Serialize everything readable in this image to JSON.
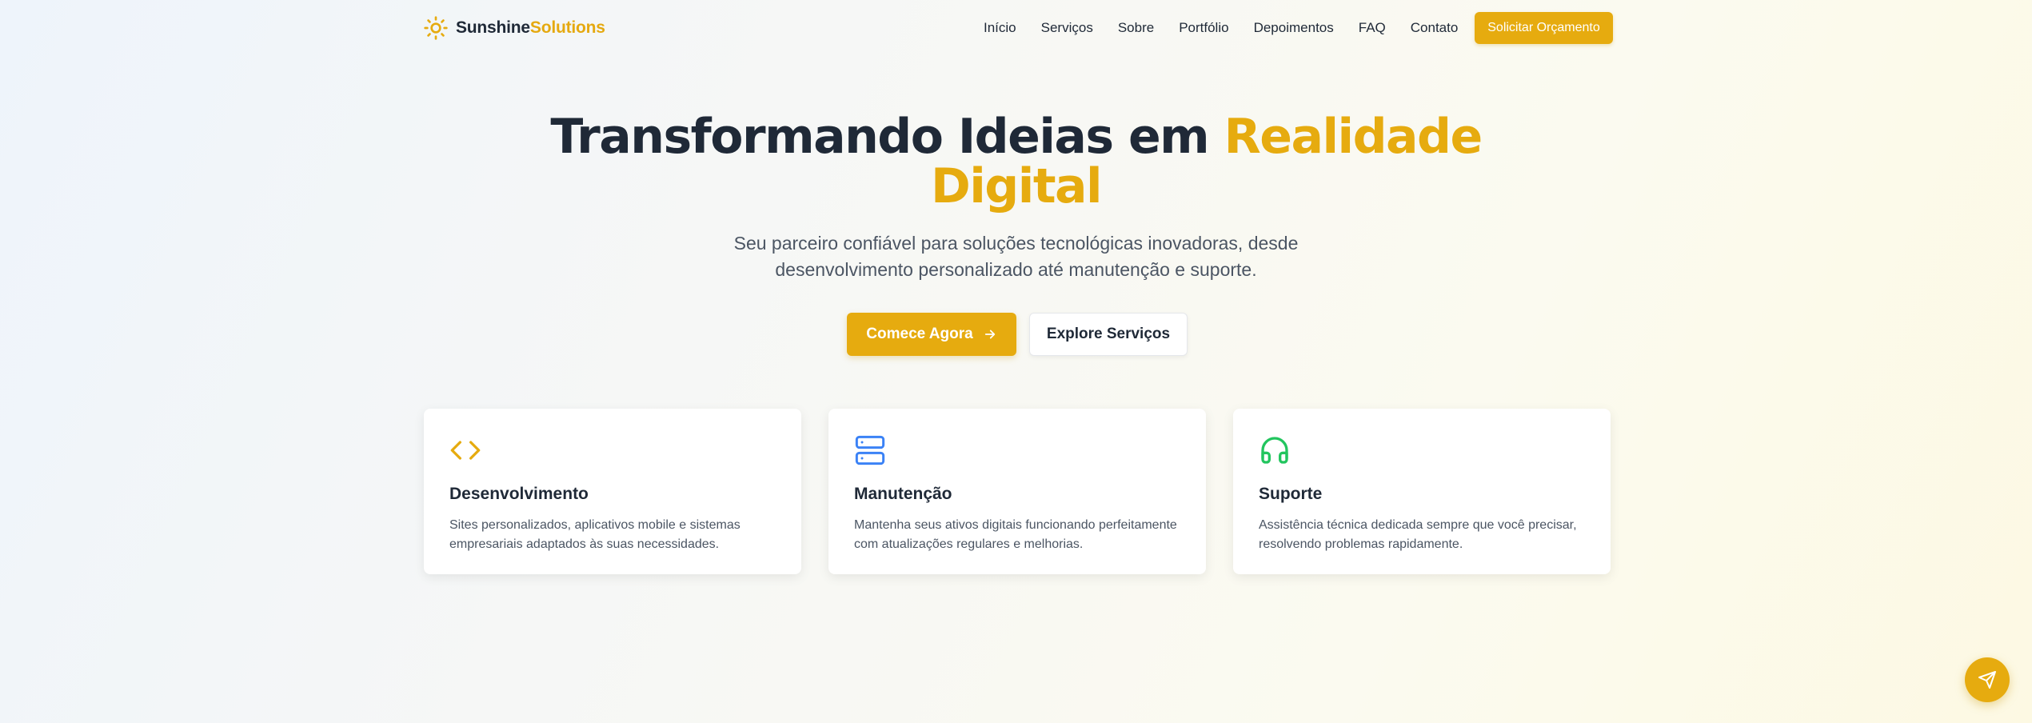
{
  "brand": {
    "name_part1": "Sunshine",
    "name_part2": "Solutions",
    "logo_icon": "sun-icon"
  },
  "nav": {
    "items": [
      {
        "label": "Início"
      },
      {
        "label": "Serviços"
      },
      {
        "label": "Sobre"
      },
      {
        "label": "Portfólio"
      },
      {
        "label": "Depoimentos"
      },
      {
        "label": "FAQ"
      },
      {
        "label": "Contato"
      }
    ],
    "cta_label": "Solicitar Orçamento"
  },
  "hero": {
    "title_plain": "Transformando Ideias em",
    "title_accent_1": "Realidade",
    "title_accent_2": "Digital",
    "subtitle_line1": "Seu parceiro confiável para soluções tecnológicas inovadoras, desde",
    "subtitle_line2": "desenvolvimento personalizado até manutenção e suporte.",
    "primary_button": "Comece Agora",
    "primary_button_icon": "arrow-right-icon",
    "secondary_button": "Explore Serviços"
  },
  "services": [
    {
      "icon": "code-icon",
      "title": "Desenvolvimento",
      "desc_line1": "Sites personalizados, aplicativos mobile e sistemas",
      "desc_line2": "empresariais adaptados às suas necessidades."
    },
    {
      "icon": "server-icon",
      "title": "Manutenção",
      "desc_line1": "Mantenha seus ativos digitais funcionando perfeitamente",
      "desc_line2": "com atualizações regulares e melhorias."
    },
    {
      "icon": "headphones-icon",
      "title": "Suporte",
      "desc_line1": "Assistência técnica dedicada sempre que você precisar,",
      "desc_line2": "resolvendo problemas rapidamente."
    }
  ],
  "colors": {
    "accent": "#e6ab0f",
    "text_dark": "#1f2937",
    "text_muted": "#4b5563",
    "code_icon": "#e6ab0f",
    "server_icon": "#3b82f6",
    "headphones_icon": "#22c55e"
  },
  "fab": {
    "icon": "send-icon"
  }
}
